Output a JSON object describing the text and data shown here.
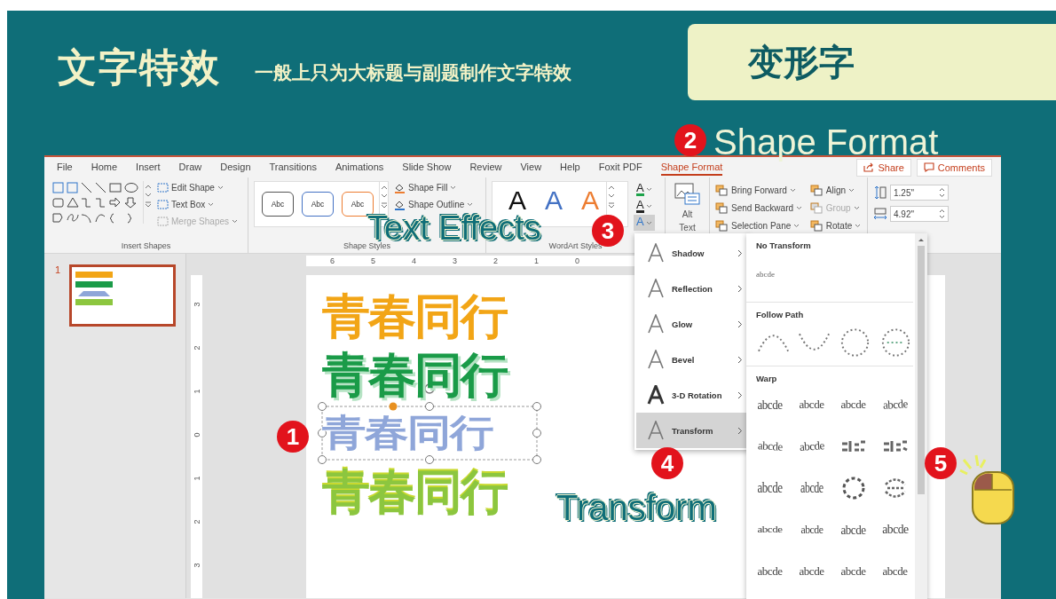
{
  "header": {
    "title": "文字特效",
    "subtitle": "一般上只为大标题与副题制作文字特效",
    "badge": "变形字"
  },
  "callouts": [
    {
      "number": "2",
      "label": "Shape Format"
    },
    {
      "number": "3",
      "label": "Text Effects"
    },
    {
      "number": "1"
    },
    {
      "number": "4",
      "label": "Transform"
    },
    {
      "number": "5"
    }
  ],
  "menu_tabs": [
    {
      "label": "File",
      "selected": false
    },
    {
      "label": "Home",
      "selected": false
    },
    {
      "label": "Insert",
      "selected": false
    },
    {
      "label": "Draw",
      "selected": false
    },
    {
      "label": "Design",
      "selected": false
    },
    {
      "label": "Transitions",
      "selected": false
    },
    {
      "label": "Animations",
      "selected": false
    },
    {
      "label": "Slide Show",
      "selected": false
    },
    {
      "label": "Review",
      "selected": false
    },
    {
      "label": "View",
      "selected": false
    },
    {
      "label": "Help",
      "selected": false
    },
    {
      "label": "Foxit PDF",
      "selected": false
    },
    {
      "label": "Shape Format",
      "selected": true
    }
  ],
  "share_button": "Share",
  "comments_button": "Comments",
  "insert_shapes": {
    "label": "Insert Shapes",
    "commands": [
      {
        "label": "Edit Shape",
        "disabled": false
      },
      {
        "label": "Text Box",
        "disabled": false
      },
      {
        "label": "Merge Shapes",
        "disabled": true
      }
    ]
  },
  "shape_styles": {
    "label": "Shape Styles",
    "swatches": [
      {
        "text": "Abc",
        "color": "#555555"
      },
      {
        "text": "Abc",
        "color": "#4472c4"
      },
      {
        "text": "Abc",
        "color": "#ed7d31"
      }
    ],
    "commands": [
      "Shape Fill",
      "Shape Outline"
    ]
  },
  "wordart_styles": {
    "label": "WordArt Styles",
    "styles": [
      {
        "glyph": "A",
        "color": "#111111"
      },
      {
        "glyph": "A",
        "color": "#4472c4"
      },
      {
        "glyph": "A",
        "color": "#ed7d31"
      }
    ],
    "format_buttons": [
      {
        "glyph": "A",
        "kind": "fill",
        "selected": false
      },
      {
        "glyph": "A",
        "kind": "outline",
        "selected": false
      },
      {
        "glyph": "A",
        "kind": "effects",
        "selected": true
      }
    ]
  },
  "alt_text": "Alt Text",
  "arrange": [
    {
      "label": "Bring Forward",
      "disabled": false
    },
    {
      "label": "Send Backward",
      "disabled": false
    },
    {
      "label": "Selection Pane",
      "disabled": false
    },
    {
      "label": "Align",
      "disabled": false
    },
    {
      "label": "Group",
      "disabled": true
    },
    {
      "label": "Rotate",
      "disabled": false
    }
  ],
  "size": {
    "height": "1.25\"",
    "width": "4.92\""
  },
  "thumbnails": [
    {
      "number": "1",
      "selected": true
    }
  ],
  "ruler": {
    "horizontal": [
      "6",
      "5",
      "4",
      "3",
      "2",
      "1",
      "0"
    ],
    "vertical": [
      "3",
      "2",
      "1",
      "0",
      "1",
      "2",
      "3"
    ]
  },
  "slide_wordart": [
    {
      "text": "青春同行",
      "kind": "solid",
      "color": "#f2a516",
      "selected": false
    },
    {
      "text": "青春同行",
      "kind": "shadow",
      "color": "#1a9b48",
      "selected": false
    },
    {
      "text": "青春同行",
      "kind": "warped",
      "color": "#8fa6d9",
      "selected": true
    },
    {
      "text": "青春同行",
      "kind": "gradient",
      "color": "#8cc63f",
      "selected": false
    }
  ],
  "effects_menu": [
    {
      "label": "Shadow",
      "selected": false
    },
    {
      "label": "Reflection",
      "selected": false
    },
    {
      "label": "Glow",
      "selected": false
    },
    {
      "label": "Bevel",
      "selected": false
    },
    {
      "label": "3-D Rotation",
      "selected": false
    },
    {
      "label": "Transform",
      "selected": true
    }
  ],
  "transform_gallery": {
    "no_transform": {
      "title": "No Transform",
      "sample": "abcde"
    },
    "follow_path": {
      "title": "Follow Path",
      "items": [
        {
          "kind": "arch-up"
        },
        {
          "kind": "arch-down"
        },
        {
          "kind": "circle"
        },
        {
          "kind": "button"
        }
      ]
    },
    "warp": {
      "title": "Warp",
      "items": [
        {
          "kind": "stop",
          "text": "abcde"
        },
        {
          "kind": "triangle-up",
          "text": "abcde"
        },
        {
          "kind": "triangle-down",
          "text": "abcde"
        },
        {
          "kind": "chevron-up",
          "text": "abcde"
        },
        {
          "kind": "chevron-down",
          "text": "abcde"
        },
        {
          "kind": "slant",
          "text": "abcde"
        },
        {
          "kind": "ring-inside"
        },
        {
          "kind": "ring-outside"
        },
        {
          "kind": "arch-up",
          "text": "abcde"
        },
        {
          "kind": "arch-down",
          "text": "abcde"
        },
        {
          "kind": "circle"
        },
        {
          "kind": "button"
        },
        {
          "kind": "inflate",
          "text": "abcde"
        },
        {
          "kind": "deflate",
          "text": "abcde"
        },
        {
          "kind": "wave",
          "text": "abcde"
        },
        {
          "kind": "fade",
          "text": "abcde"
        },
        {
          "kind": "plain",
          "text": "abcde"
        },
        {
          "kind": "cascade",
          "text": "abcde"
        },
        {
          "kind": "plain",
          "text": "abcde"
        },
        {
          "kind": "plain",
          "text": "abcde"
        }
      ]
    }
  }
}
